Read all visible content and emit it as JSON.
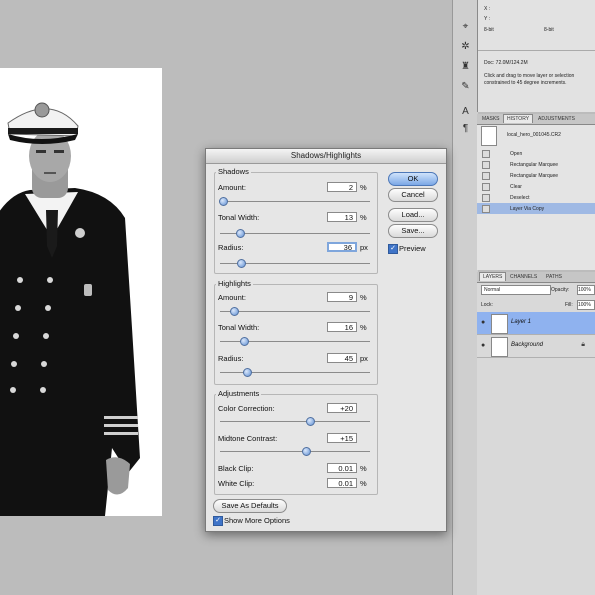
{
  "dialog": {
    "title": "Shadows/Highlights",
    "shadows": {
      "title": "Shadows",
      "amount": {
        "label": "Amount:",
        "value": "2",
        "unit": "%",
        "level": 0.02
      },
      "tonal_width": {
        "label": "Tonal Width:",
        "value": "13",
        "unit": "%",
        "level": 0.13
      },
      "radius": {
        "label": "Radius:",
        "value": "36",
        "unit": "px",
        "level": 0.14
      }
    },
    "highlights": {
      "title": "Highlights",
      "amount": {
        "label": "Amount:",
        "value": "9",
        "unit": "%",
        "level": 0.09
      },
      "tonal_width": {
        "label": "Tonal Width:",
        "value": "16",
        "unit": "%",
        "level": 0.16
      },
      "radius": {
        "label": "Radius:",
        "value": "45",
        "unit": "px",
        "level": 0.18
      }
    },
    "adjustments": {
      "title": "Adjustments",
      "color_correction": {
        "label": "Color Correction:",
        "value": "+20",
        "level": 0.6
      },
      "midtone_contrast": {
        "label": "Midtone Contrast:",
        "value": "+15",
        "level": 0.57
      },
      "black_clip": {
        "label": "Black Clip:",
        "value": "0.01",
        "unit": "%"
      },
      "white_clip": {
        "label": "White Clip:",
        "value": "0.01",
        "unit": "%"
      }
    },
    "buttons": {
      "ok": "OK",
      "cancel": "Cancel",
      "load": "Load...",
      "save": "Save...",
      "save_defaults": "Save As Defaults"
    },
    "preview_label": "Preview",
    "show_more_label": "Show More Options"
  },
  "info_panel": {
    "doc": "Doc: 72.0M/124.2M",
    "hint": "Click and drag to move layer or selection constrained to 45 degree increments.",
    "bit_left": "8-bit",
    "bit_right": "8-bit",
    "x_label": "X :",
    "y_label": "Y :"
  },
  "history_panel": {
    "tabs": [
      "MASKS",
      "HISTORY",
      "ADJUSTMENTS"
    ],
    "snapshot": "local_hero_001045.CR2",
    "items": [
      "Open",
      "Rectangular Marquee",
      "Rectangular Marquee",
      "Clear",
      "Deselect",
      "Layer Via Copy"
    ]
  },
  "layers_panel": {
    "tabs": [
      "LAYERS",
      "CHANNELS",
      "PATHS"
    ],
    "blend_mode": "Normal",
    "opacity_label": "Opacity:",
    "opacity_value": "100%",
    "fill_label": "Fill:",
    "fill_value": "100%",
    "lock_label": "Lock:",
    "layers": [
      {
        "name": "Layer 1",
        "selected": true
      },
      {
        "name": "Background",
        "selected": false
      }
    ]
  },
  "icons": [
    "eyedropper-icon",
    "gear-icon",
    "clone-icon",
    "text-icon",
    "paragraph-icon",
    "eye-icon",
    "lock-icon"
  ],
  "colors": {
    "accent": "#7ba8e6",
    "selection": "#8fb2ef",
    "background": "#bcbcbc"
  }
}
